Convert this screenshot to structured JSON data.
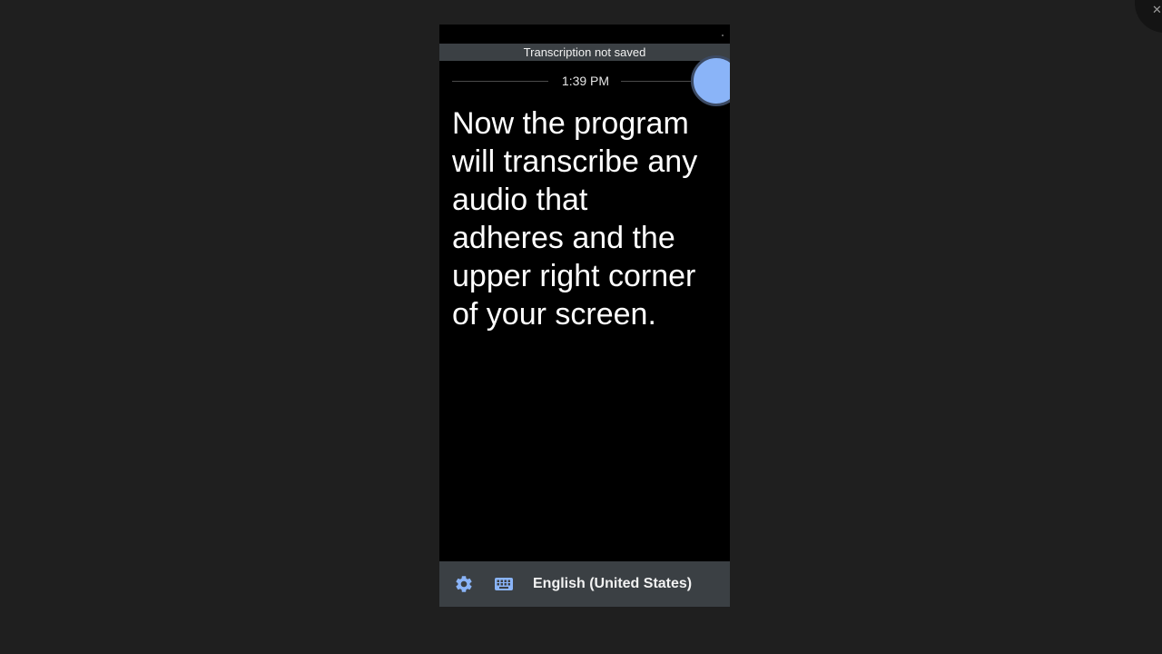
{
  "window": {
    "close_glyph": "✕"
  },
  "app": {
    "banner": "Transcription not saved",
    "time": "1:39 PM",
    "transcript": "Now the program\nwill transcribe any\naudio that\nadheres and the\nupper right corner\nof your screen.",
    "language": "English (United States)",
    "icons": {
      "settings": "gear-icon",
      "keyboard": "keyboard-icon",
      "mic": "listening-indicator"
    },
    "colors": {
      "accent": "#8ab4f8",
      "bar": "#3b4044",
      "background": "#000000"
    }
  }
}
